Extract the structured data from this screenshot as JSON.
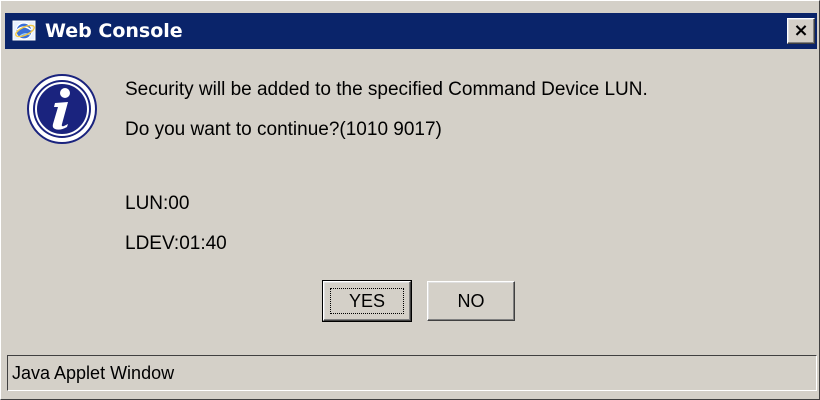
{
  "window": {
    "title": "Web Console",
    "close_label": "×"
  },
  "message": {
    "line1": "Security will be added to the specified Command Device LUN.",
    "line2": "Do you want to continue?(1010 9017)",
    "lun": "LUN:00",
    "ldev": "LDEV:01:40"
  },
  "buttons": {
    "yes": "YES",
    "no": "NO"
  },
  "status_bar": {
    "text": "Java Applet Window"
  },
  "icons": {
    "title": "browser-globe-icon",
    "dialog": "information-icon"
  },
  "colors": {
    "titlebar": "#0a246a",
    "window_bg": "#d4d0c8",
    "info_icon_fill": "#1a237e"
  }
}
